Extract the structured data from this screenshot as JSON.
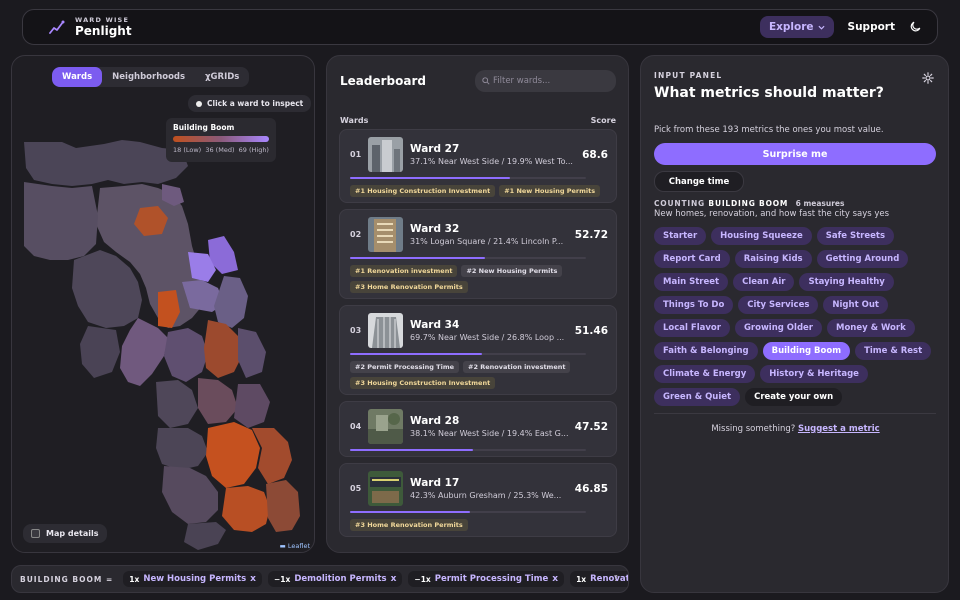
{
  "header": {
    "brand_top": "WARD WISE",
    "brand_name": "Penlight",
    "explore_label": "Explore",
    "support_label": "Support"
  },
  "map": {
    "tabs": [
      {
        "label": "Wards",
        "active": true
      },
      {
        "label": "Neighborhoods",
        "active": false
      },
      {
        "label": "χGRIDs",
        "active": false
      }
    ],
    "inspect_hint": "Click a ward to inspect",
    "legend": {
      "title": "Building Boom",
      "low": "18 (Low)",
      "med": "36 (Med)",
      "high": "69 (High)"
    },
    "details_label": "Map details",
    "attribution": "Leaflet"
  },
  "leaderboard": {
    "title": "Leaderboard",
    "search_placeholder": "Filter wards...",
    "col_wards": "Wards",
    "col_score": "Score",
    "wards": [
      {
        "rank": "01",
        "name": "Ward 27",
        "desc": "37.1% Near West Side / 19.9% West To...",
        "score": "68.6",
        "fill": 0.68,
        "tags": [
          {
            "text": "#1 Housing Construction Investment",
            "alt": false
          },
          {
            "text": "#1 New Housing Permits",
            "alt": false
          }
        ]
      },
      {
        "rank": "02",
        "name": "Ward 32",
        "desc": "31% Logan Square / 21.4% Lincoln P...",
        "score": "52.72",
        "fill": 0.57,
        "tags": [
          {
            "text": "#1 Renovation investment",
            "alt": false
          },
          {
            "text": "#2 New Housing Permits",
            "alt": true
          },
          {
            "text": "#3 Home Renovation Permits",
            "alt": false
          }
        ]
      },
      {
        "rank": "03",
        "name": "Ward 34",
        "desc": "69.7% Near West Side / 26.8% Loop ...",
        "score": "51.46",
        "fill": 0.56,
        "tags": [
          {
            "text": "#2 Permit Processing Time",
            "alt": true
          },
          {
            "text": "#2 Renovation investment",
            "alt": true
          },
          {
            "text": "#3 Housing Construction Investment",
            "alt": false
          }
        ]
      },
      {
        "rank": "04",
        "name": "Ward 28",
        "desc": "38.1% Near West Side / 19.4% East G...",
        "score": "47.52",
        "fill": 0.52,
        "tags": []
      },
      {
        "rank": "05",
        "name": "Ward 17",
        "desc": "42.3% Auburn Gresham / 25.3% We...",
        "score": "46.85",
        "fill": 0.51,
        "tags": [
          {
            "text": "#3 Home Renovation Permits",
            "alt": false
          }
        ]
      }
    ]
  },
  "input_panel": {
    "label": "INPUT PANEL",
    "title": "What metrics should matter?",
    "subtitle": "Pick from these 193 metrics the ones you most value.",
    "surprise_label": "Surprise me",
    "change_time_label": "Change time",
    "counting_prefix": "COUNTING",
    "counting_name": "BUILDING BOOM",
    "counting_measures": "6 measures",
    "counting_desc": "New homes, renovation, and how fast the city says yes",
    "chips": [
      {
        "label": "Starter",
        "state": "normal"
      },
      {
        "label": "Housing Squeeze",
        "state": "normal"
      },
      {
        "label": "Safe Streets",
        "state": "normal"
      },
      {
        "label": "Report Card",
        "state": "normal"
      },
      {
        "label": "Raising Kids",
        "state": "normal"
      },
      {
        "label": "Getting Around",
        "state": "normal"
      },
      {
        "label": "Main Street",
        "state": "normal"
      },
      {
        "label": "Clean Air",
        "state": "normal"
      },
      {
        "label": "Staying Healthy",
        "state": "normal"
      },
      {
        "label": "Things To Do",
        "state": "normal"
      },
      {
        "label": "City Services",
        "state": "normal"
      },
      {
        "label": "Night Out",
        "state": "normal"
      },
      {
        "label": "Local Flavor",
        "state": "normal"
      },
      {
        "label": "Growing Older",
        "state": "normal"
      },
      {
        "label": "Money & Work",
        "state": "normal"
      },
      {
        "label": "Faith & Belonging",
        "state": "normal"
      },
      {
        "label": "Building Boom",
        "state": "active"
      },
      {
        "label": "Time & Rest",
        "state": "normal"
      },
      {
        "label": "Climate & Energy",
        "state": "normal"
      },
      {
        "label": "History & Heritage",
        "state": "normal"
      },
      {
        "label": "Green & Quiet",
        "state": "normal"
      },
      {
        "label": "Create your own",
        "state": "plain"
      }
    ],
    "missing_text": "Missing something?",
    "suggest_label": "Suggest a metric"
  },
  "formula": {
    "label": "BUILDING BOOM =",
    "terms": [
      {
        "weight": "1x",
        "name": "New Housing Permits"
      },
      {
        "weight": "−1x",
        "name": "Demolition Permits"
      },
      {
        "weight": "−1x",
        "name": "Permit Processing Time"
      },
      {
        "weight": "1x",
        "name": "Renovation in"
      }
    ],
    "remove_glyph": "x",
    "help": "?"
  },
  "colors": {
    "accent": "#8e6dff",
    "chip_bg": "#3d2f5e",
    "low": "#c0501e",
    "high": "#a987ff"
  }
}
